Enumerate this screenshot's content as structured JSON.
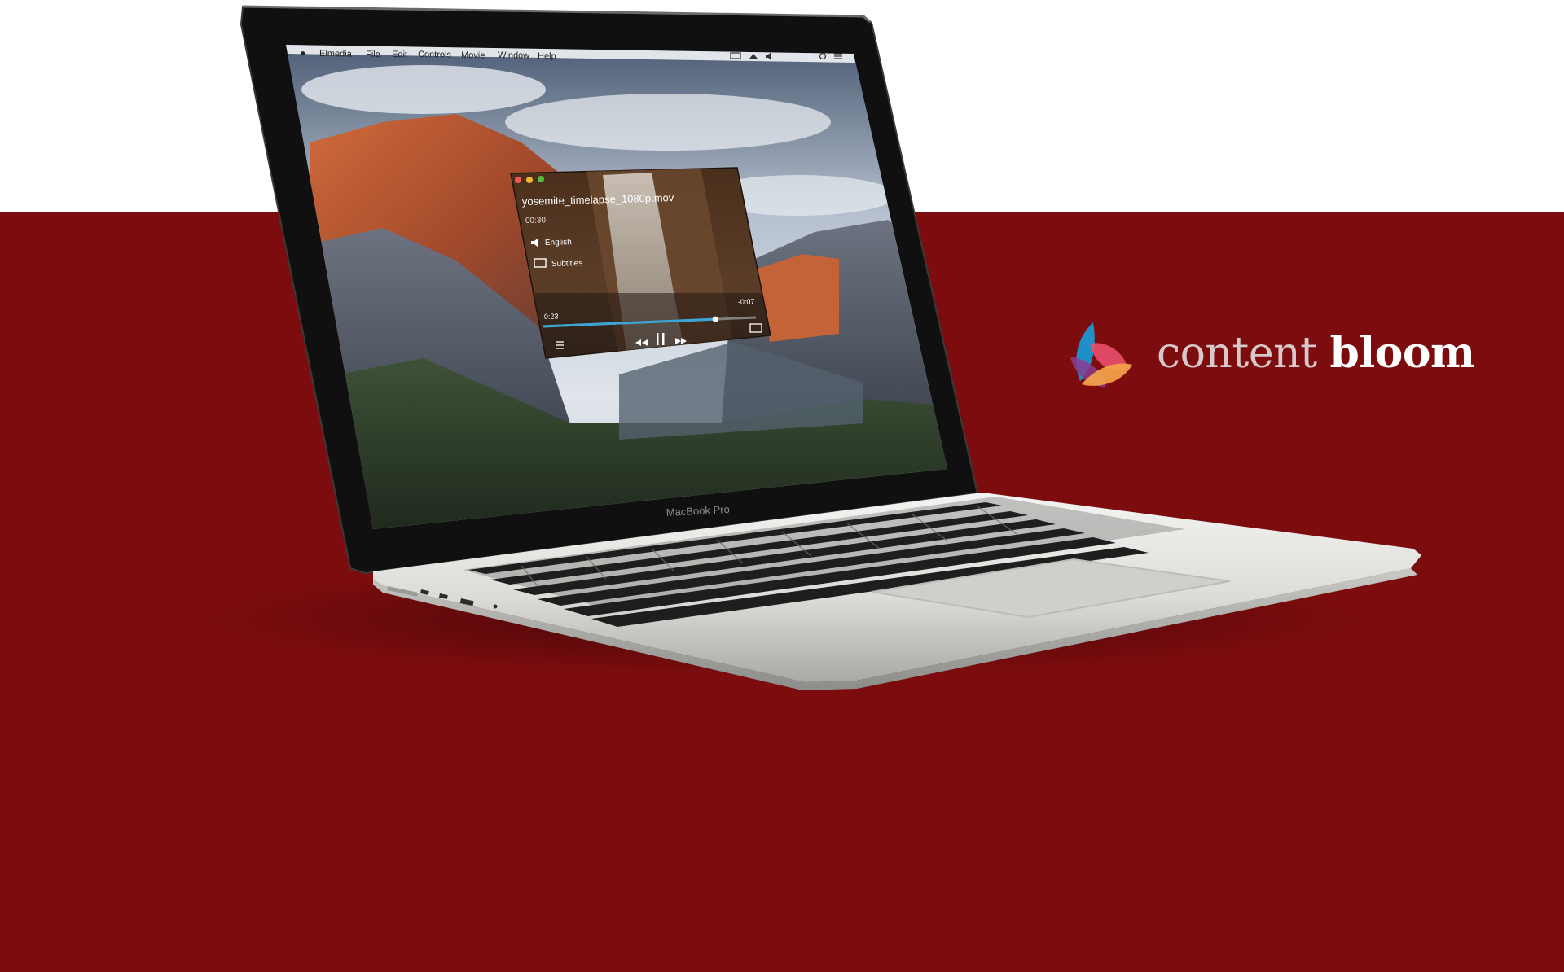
{
  "brand": {
    "word1": "content",
    "word2": "bloom",
    "logo_colors": [
      "#1f8fc7",
      "#e94f6b",
      "#f5a44a",
      "#8a3c8f"
    ]
  },
  "laptop": {
    "model_label": "MacBook Pro",
    "body_color": "#d9d9d6",
    "bezel_color": "#0c0c0c"
  },
  "menubar": {
    "apple_icon": "apple-icon",
    "items": [
      "Elmedia",
      "File",
      "Edit",
      "Controls",
      "Movie",
      "Window",
      "Help"
    ],
    "status_icons": [
      "battery-icon",
      "wifi-icon",
      "volume-icon",
      "search-icon",
      "list-icon"
    ]
  },
  "wallpaper": {
    "sky": "#c9d3df",
    "rock": "#b65a36",
    "forest": "#2e3f2a"
  },
  "player": {
    "filename": "yosemite_timelapse_1080p.mov",
    "duration": "00:30",
    "audio_label": "English",
    "subtitles_label": "Subtitles",
    "time_elapsed": "0:23",
    "time_remaining": "-0:07",
    "progress": 0.81,
    "accent": "#3aa6d8",
    "controls": [
      "playlist-icon",
      "rewind-icon",
      "pause-icon",
      "forward-icon",
      "airplay-icon"
    ]
  }
}
